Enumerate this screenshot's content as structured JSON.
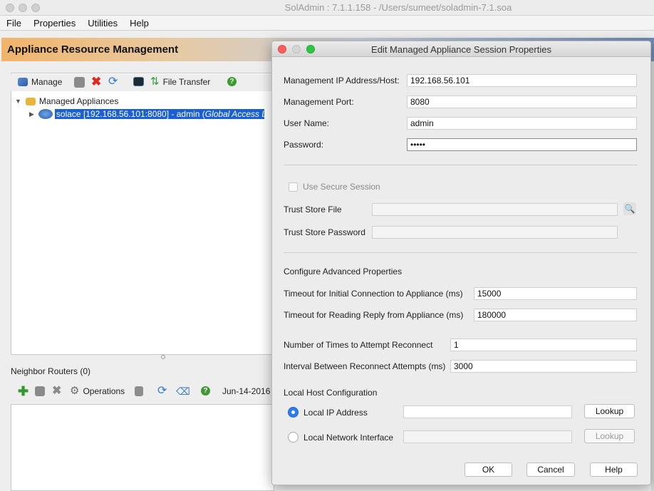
{
  "window": {
    "title": "SolAdmin : 7.1.1.158 - /Users/sumeet/soladmin-7.1.soa"
  },
  "menu": [
    "File",
    "Properties",
    "Utilities",
    "Help"
  ],
  "banner": {
    "title": "Appliance Resource Management"
  },
  "toolbar": {
    "manage": "Manage",
    "file_transfer": "File Transfer"
  },
  "tree": {
    "root": "Managed Appliances",
    "child": "solace [192.168.56.101:8080] - admin (",
    "child_italic": "Global Access Level: A"
  },
  "neighbor": {
    "label": "Neighbor Routers (0)",
    "operations": "Operations",
    "date": "Jun-14-2016"
  },
  "dialog": {
    "title": "Edit Managed Appliance Session Properties",
    "fields": {
      "ip_label": "Management IP Address/Host:",
      "ip_value": "192.168.56.101",
      "port_label": "Management Port:",
      "port_value": "8080",
      "user_label": "User Name:",
      "user_value": "admin",
      "password_label": "Password:",
      "password_value": "•••••"
    },
    "secure": {
      "checkbox_label": "Use Secure Session",
      "trust_store_file_label": "Trust Store File",
      "trust_store_password_label": "Trust Store Password"
    },
    "advanced": {
      "heading": "Configure Advanced Properties",
      "timeout_initial_label": "Timeout for Initial Connection to Appliance (ms)",
      "timeout_initial_value": "15000",
      "timeout_reply_label": "Timeout for Reading Reply from Appliance (ms)",
      "timeout_reply_value": "180000",
      "reconnect_attempts_label": "Number of Times to Attempt Reconnect",
      "reconnect_attempts_value": "1",
      "reconnect_interval_label": "Interval Between Reconnect Attempts (ms)",
      "reconnect_interval_value": "3000"
    },
    "local_host": {
      "heading": "Local Host Configuration",
      "local_ip_label": "Local IP Address",
      "local_nic_label": "Local Network Interface",
      "lookup_label": "Lookup",
      "selected": "Local IP Address"
    },
    "buttons": {
      "ok": "OK",
      "cancel": "Cancel",
      "help": "Help"
    }
  },
  "colors": {
    "selection": "#1a5fd6",
    "radio_on": "#2d7cf6",
    "banner_start": "#f1b46a",
    "banner_end": "#6f8db8"
  }
}
